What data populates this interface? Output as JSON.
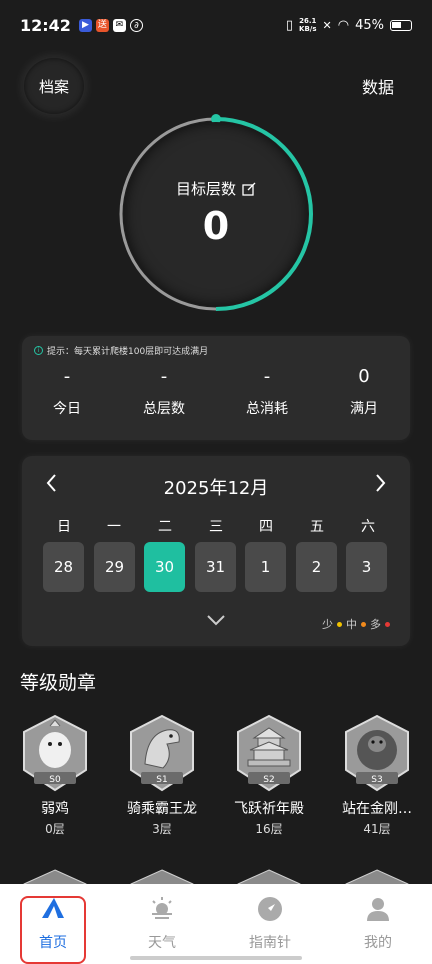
{
  "status_bar": {
    "time": "12:42",
    "speed_top": "26.1",
    "speed_unit": "KB/s",
    "battery": "45%"
  },
  "header": {
    "archive_label": "档案",
    "data_label": "数据"
  },
  "ring": {
    "label": "目标层数",
    "value": "0",
    "accent": "#25c5a5"
  },
  "stats": {
    "tip": "提示：每天累计爬楼100层即可达成满月",
    "items": [
      {
        "value": "-",
        "label": "今日"
      },
      {
        "value": "-",
        "label": "总层数"
      },
      {
        "value": "-",
        "label": "总消耗"
      },
      {
        "value": "0",
        "label": "满月"
      }
    ]
  },
  "calendar": {
    "title": "2025年12月",
    "prev_icon": "chevron-left-icon",
    "next_icon": "chevron-right-icon",
    "weekdays": [
      "日",
      "一",
      "二",
      "三",
      "四",
      "五",
      "六"
    ],
    "days": [
      "28",
      "29",
      "30",
      "31",
      "1",
      "2",
      "3"
    ],
    "selected": "30",
    "expand_icon": "chevron-down-icon",
    "legend": [
      {
        "label": "少",
        "color": "#f2c200"
      },
      {
        "label": "中",
        "color": "#f28a1c"
      },
      {
        "label": "多",
        "color": "#e53935"
      }
    ]
  },
  "medals_title": "等级勋章",
  "medals": [
    {
      "name": "弱鸡",
      "floor": "0层",
      "code": "S0"
    },
    {
      "name": "骑乘霸王龙",
      "floor": "3层",
      "code": "S1"
    },
    {
      "name": "飞跃祈年殿",
      "floor": "16层",
      "code": "S2"
    },
    {
      "name": "站在金刚…",
      "floor": "41层",
      "code": "S3"
    }
  ],
  "tabs": [
    {
      "label": "首页",
      "icon": "home-icon",
      "active": true
    },
    {
      "label": "天气",
      "icon": "weather-icon",
      "active": false
    },
    {
      "label": "指南针",
      "icon": "compass-icon",
      "active": false
    },
    {
      "label": "我的",
      "icon": "profile-icon",
      "active": false
    }
  ]
}
